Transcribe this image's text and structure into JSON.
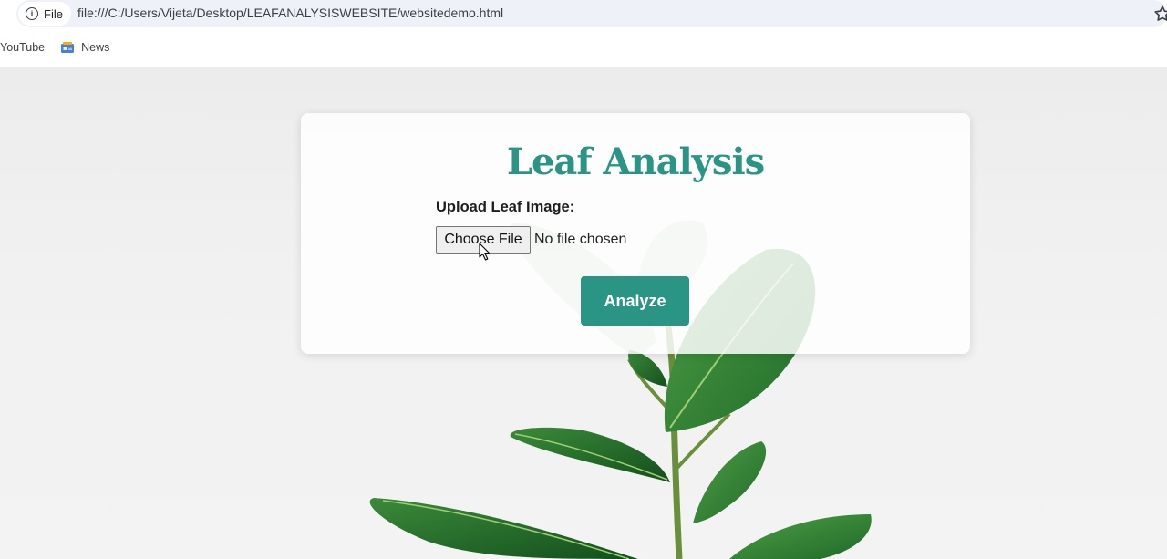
{
  "browser": {
    "file_chip_label": "File",
    "url": "file:///C:/Users/Vijeta/Desktop/LEAFANALYSISWEBSITE/websitedemo.html",
    "bookmarks": [
      {
        "label": "YouTube"
      },
      {
        "label": "News"
      }
    ]
  },
  "page": {
    "title": "Leaf Analysis",
    "upload_label": "Upload Leaf Image:",
    "choose_file_label": "Choose File",
    "file_status": "No file chosen",
    "analyze_label": "Analyze"
  },
  "colors": {
    "accent": "#2a9585",
    "leaf": "#2f7d35",
    "background": "#efefef"
  }
}
